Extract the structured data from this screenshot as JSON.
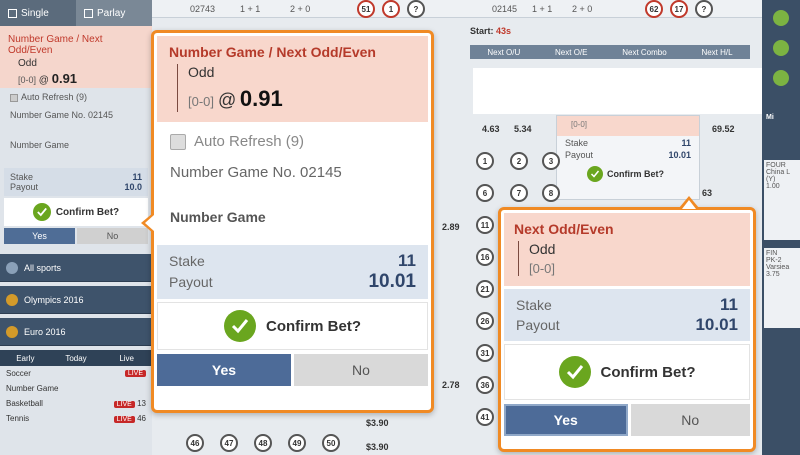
{
  "sidebar": {
    "tabs": [
      "Single",
      "Parlay"
    ],
    "slip": {
      "title": "Number Game / Next Odd/Even",
      "option": "Odd",
      "handicap": "[0-0]",
      "at": "@",
      "odds": "0.91"
    },
    "auto_refresh": "Auto Refresh (9)",
    "game_no": "Number Game No. 02145",
    "game_type": "Number Game",
    "stake_label": "Stake",
    "stake_value": "11",
    "payout_label": "Payout",
    "payout_value": "10.0",
    "confirm": "Confirm Bet?",
    "yes": "Yes",
    "no": "No",
    "menu": [
      "All sports",
      "Olympics 2016",
      "Euro 2016"
    ],
    "subtabs": [
      "Early",
      "Today",
      "Live"
    ],
    "sports": [
      {
        "name": "Soccer",
        "badge": "LIVE",
        "count": ""
      },
      {
        "name": "Number Game",
        "badge": "",
        "count": ""
      },
      {
        "name": "Basketball",
        "badge": "LIVE",
        "count": "13"
      },
      {
        "name": "Tennis",
        "badge": "LIVE",
        "count": "46"
      }
    ]
  },
  "board": {
    "top": [
      "02743",
      "1 + 1",
      "2 + 0",
      "02145",
      "1 + 1",
      "2 + 0"
    ],
    "top_balls": [
      "51",
      "1",
      "?",
      "62",
      "17",
      "?"
    ],
    "start_label": "Start:",
    "start_value": "43s",
    "headers": [
      "Next O/U",
      "Next O/E",
      "Next Combo",
      "Next H/L"
    ],
    "odds": [
      "4.63",
      "5.34",
      "69.52",
      "2.89",
      "2.78",
      "63",
      "$3.90",
      "$3.90"
    ],
    "handicap_small": "[0-0]",
    "stake_label": "Stake",
    "stake_value": "11",
    "payout_label": "Payout",
    "payout_value": "10.01",
    "confirm": "Confirm Bet?",
    "balls": [
      "1",
      "2",
      "3",
      "6",
      "7",
      "8",
      "11",
      "16",
      "21",
      "26",
      "31",
      "36",
      "41",
      "46",
      "47",
      "48",
      "49",
      "50"
    ]
  },
  "right_sidebar": {
    "labels": [
      "Mi",
      "FOUR",
      "China L",
      "(Y)",
      "1.00",
      "FIN",
      "PK-2",
      "Varsiea",
      "3.75"
    ]
  },
  "popup1": {
    "title": "Number Game / Next Odd/Even",
    "option": "Odd",
    "handicap": "[0-0]",
    "at": "@",
    "odds": "0.91",
    "auto_refresh": "Auto Refresh (9)",
    "game_no": "Number Game No. 02145",
    "game_type": "Number Game",
    "stake_label": "Stake",
    "stake_value": "11",
    "payout_label": "Payout",
    "payout_value": "10.01",
    "confirm": "Confirm Bet?",
    "yes": "Yes",
    "no": "No"
  },
  "popup2": {
    "title": "Next Odd/Even",
    "option": "Odd",
    "handicap": "[0-0]",
    "stake_label": "Stake",
    "stake_value": "11",
    "payout_label": "Payout",
    "payout_value": "10.01",
    "confirm": "Confirm Bet?",
    "yes": "Yes",
    "no": "No"
  },
  "colors": {
    "accent_border": "#f08a24",
    "slip_bg": "#f8d7cc",
    "title_red": "#b53a2a",
    "yes_blue": "#4d6b98",
    "check_green": "#6aa61f"
  }
}
